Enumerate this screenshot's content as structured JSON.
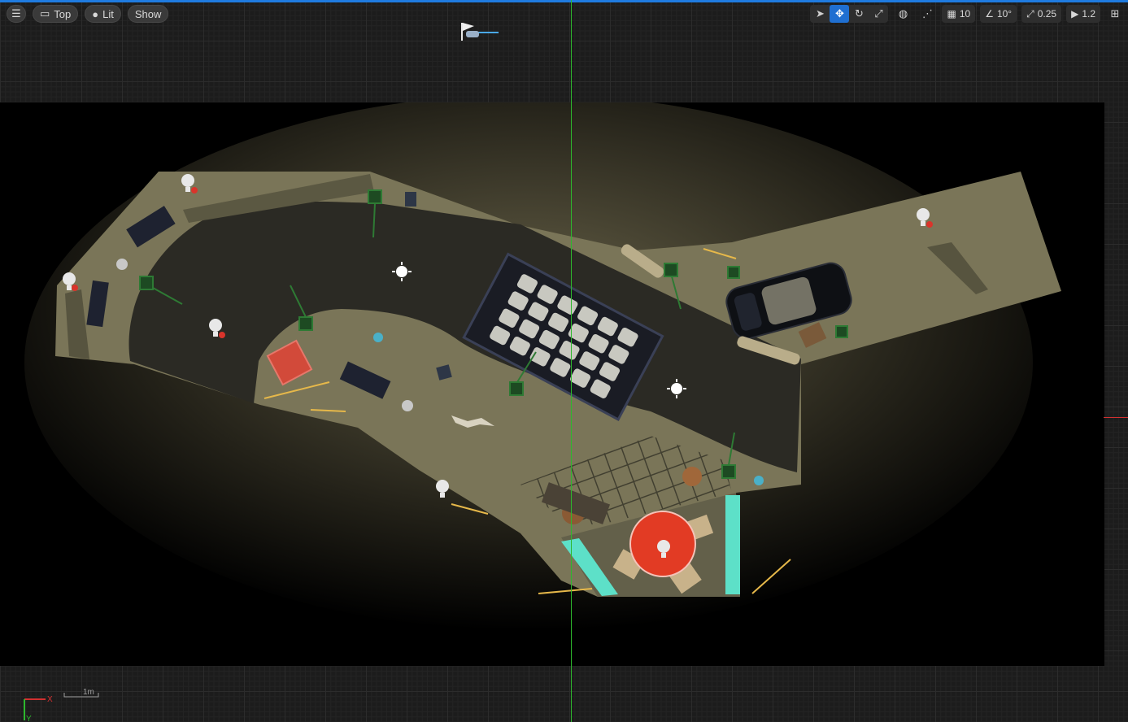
{
  "toolbar": {
    "menu_icon": "hamburger-icon",
    "view_mode": "Top",
    "lighting_mode": "Lit",
    "show_label": "Show",
    "grid_snap_value": "10",
    "rotation_snap_value": "10°",
    "scale_snap_value": "0.25",
    "camera_speed_value": "1.2"
  },
  "viewport": {
    "scale_bar_label": "1m",
    "axis_x_label": "X",
    "axis_y_label": "Y"
  },
  "colors": {
    "grid_bg": "#1c1c1c",
    "active_tool": "#1f6fd1",
    "y_axis": "#2db82d",
    "x_axis": "#d23030",
    "floor": "#7a7558",
    "road": "#2b2a24",
    "cube": "#d24a3a",
    "table": "#e23b24",
    "glass": "#5de0c8"
  }
}
